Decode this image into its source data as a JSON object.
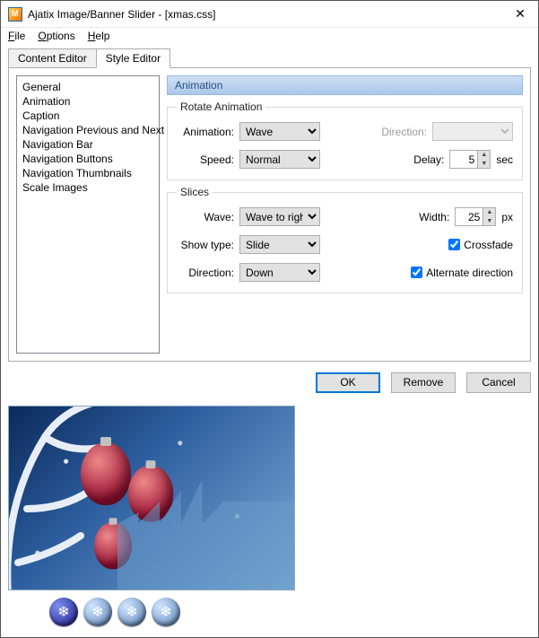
{
  "window": {
    "title": "Ajatix Image/Banner Slider - [xmas.css]"
  },
  "menu": {
    "file": "File",
    "options": "Options",
    "help": "Help"
  },
  "tabs": {
    "content": "Content Editor",
    "style": "Style Editor"
  },
  "sidebar": {
    "items": [
      "General",
      "Animation",
      "Caption",
      "Navigation Previous and Next",
      "Navigation Bar",
      "Navigation Buttons",
      "Navigation Thumbnails",
      "Scale Images"
    ]
  },
  "section": {
    "title": "Animation"
  },
  "rotate": {
    "legend": "Rotate Animation",
    "animation_label": "Animation:",
    "animation_value": "Wave",
    "direction_label": "Direction:",
    "direction_value": "",
    "speed_label": "Speed:",
    "speed_value": "Normal",
    "delay_label": "Delay:",
    "delay_value": "5",
    "delay_unit": "sec"
  },
  "slices": {
    "legend": "Slices",
    "wave_label": "Wave:",
    "wave_value": "Wave to right",
    "width_label": "Width:",
    "width_value": "25",
    "width_unit": "px",
    "showtype_label": "Show type:",
    "showtype_value": "Slide",
    "crossfade_label": "Crossfade",
    "crossfade_checked": true,
    "direction_label": "Direction:",
    "direction_value": "Down",
    "alternate_label": "Alternate direction",
    "alternate_checked": true
  },
  "buttons": {
    "ok": "OK",
    "remove": "Remove",
    "cancel": "Cancel"
  }
}
